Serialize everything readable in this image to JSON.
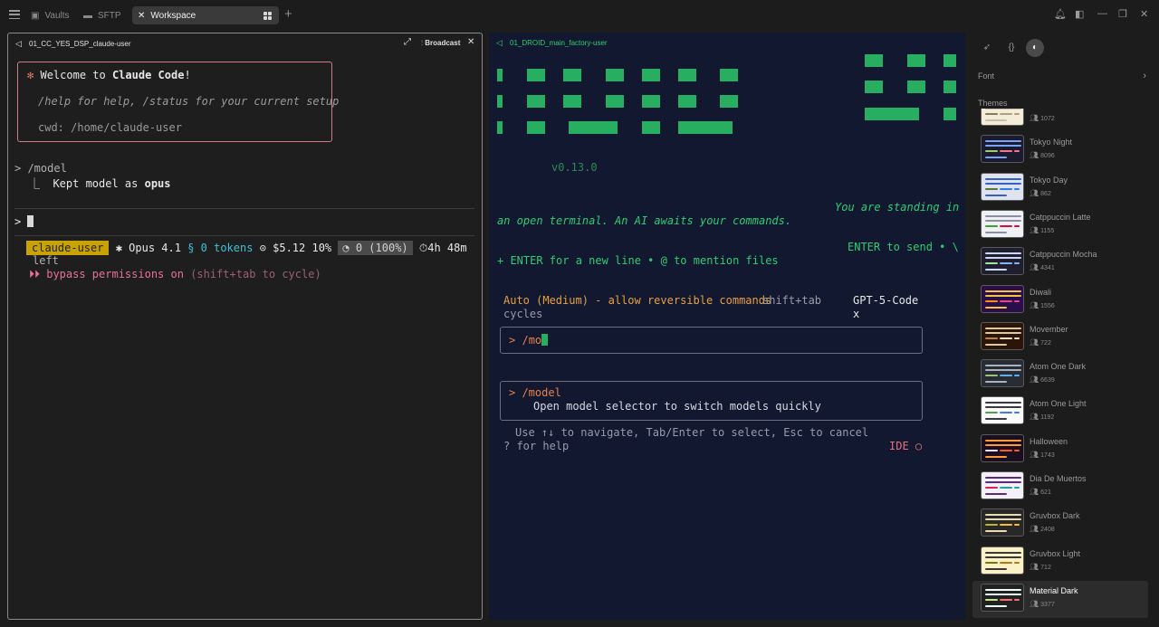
{
  "topbar": {
    "tabs": [
      {
        "label": "Vaults",
        "icon": "vault-icon"
      },
      {
        "label": "SFTP",
        "icon": "folder-icon"
      },
      {
        "label": "Workspace",
        "icon": "close-icon"
      }
    ]
  },
  "left_pane": {
    "title": "01_CC_YES_DSP_claude-user",
    "broadcast_label": "Broadcast",
    "welcome_prefix": "Welcome to ",
    "welcome_app": "Claude Code",
    "welcome_suffix": "!",
    "help_line": "/help for help, /status for your current setup",
    "cwd_line": "cwd: /home/claude-user",
    "cmd": "> /model",
    "result_prefix": "⎿  Kept model as ",
    "result_model": "opus",
    "prompt": ">",
    "status": {
      "user": "claude-user",
      "model": "✱ Opus 4.1",
      "tokens": "§ 0 tokens",
      "cost": "⊙ $5.12 10%",
      "usage": "◔ 0 (100%)",
      "time": "⏱4h 48m",
      "time_cont": "left"
    },
    "bypass_label": "⏵⏵ bypass permissions on",
    "bypass_hint": "(shift+tab to cycle)"
  },
  "right_pane": {
    "title": "01_DROID_main_factory-user",
    "version": "v0.13.0",
    "standing_1": "You are standing in",
    "standing_2": "an open terminal. An AI awaits your commands.",
    "enter_1": "ENTER to send • \\",
    "enter_2": "+ ENTER for a new line • @ to mention files",
    "auto_mode": "Auto (Medium) - allow reversible commands",
    "shift_tab": "shift+tab",
    "cycles": "cycles",
    "model_1": "GPT-5-Code",
    "model_2": "x",
    "input_prompt": ">",
    "input_value": "/mo",
    "cmd_name": "> /model",
    "cmd_desc": "Open model selector to switch models quickly",
    "nav_hint": "Use ↑↓ to navigate, Tab/Enter to select, Esc to cancel",
    "help_hint": "? for help",
    "ide": "IDE ○"
  },
  "sidebar": {
    "font_label": "Font",
    "themes_label": "Themes",
    "themes": [
      {
        "name": "",
        "count": "1072",
        "bg": "#f2ecd8",
        "bar": "#c8c0a8",
        "a": "#8a7a5a",
        "b": "#b0a080"
      },
      {
        "name": "Tokyo Night",
        "count": "8096",
        "bg": "#1a1b2e",
        "bar": "#7aa2f7",
        "a": "#9ece6a",
        "b": "#f7768e"
      },
      {
        "name": "Tokyo Day",
        "count": "862",
        "bg": "#dfe3f0",
        "bar": "#3760bf",
        "a": "#587539",
        "b": "#2e7de9"
      },
      {
        "name": "Catppuccin Latte",
        "count": "1155",
        "bg": "#eff1f5",
        "bar": "#8c8fa1",
        "a": "#40a02b",
        "b": "#d20f39"
      },
      {
        "name": "Catppuccin Mocha",
        "count": "4341",
        "bg": "#1e1e2e",
        "bar": "#cdd6f4",
        "a": "#a6e3a1",
        "b": "#89b4fa"
      },
      {
        "name": "Diwali",
        "count": "1556",
        "bg": "#2a0e4a",
        "bar": "#f5c242",
        "a": "#ff8c1a",
        "b": "#e84393"
      },
      {
        "name": "Movember",
        "count": "722",
        "bg": "#2a1508",
        "bar": "#e0c8a0",
        "a": "#c08040",
        "b": "#f0e0c0"
      },
      {
        "name": "Atom One Dark",
        "count": "6639",
        "bg": "#282c34",
        "bar": "#abb2bf",
        "a": "#98c379",
        "b": "#61afef"
      },
      {
        "name": "Atom One Light",
        "count": "1192",
        "bg": "#fafafa",
        "bar": "#383a42",
        "a": "#50a14f",
        "b": "#4078f2"
      },
      {
        "name": "Halloween",
        "count": "1743",
        "bg": "#1a0f1e",
        "bar": "#ff9a3c",
        "a": "#f0e0ff",
        "b": "#ff5a1f"
      },
      {
        "name": "Dia De Muertos",
        "count": "621",
        "bg": "#f4f0f8",
        "bar": "#5a2a80",
        "a": "#e0205a",
        "b": "#20a0a0"
      },
      {
        "name": "Gruvbox Dark",
        "count": "2408",
        "bg": "#282828",
        "bar": "#ebdbb2",
        "a": "#b8bb26",
        "b": "#fabd2f"
      },
      {
        "name": "Gruvbox Light",
        "count": "712",
        "bg": "#fbf1c7",
        "bar": "#3c3836",
        "a": "#79740e",
        "b": "#b57614"
      },
      {
        "name": "Material Dark",
        "count": "3377",
        "bg": "#212121",
        "bar": "#eeffff",
        "a": "#c3e88d",
        "b": "#f07178"
      }
    ]
  }
}
